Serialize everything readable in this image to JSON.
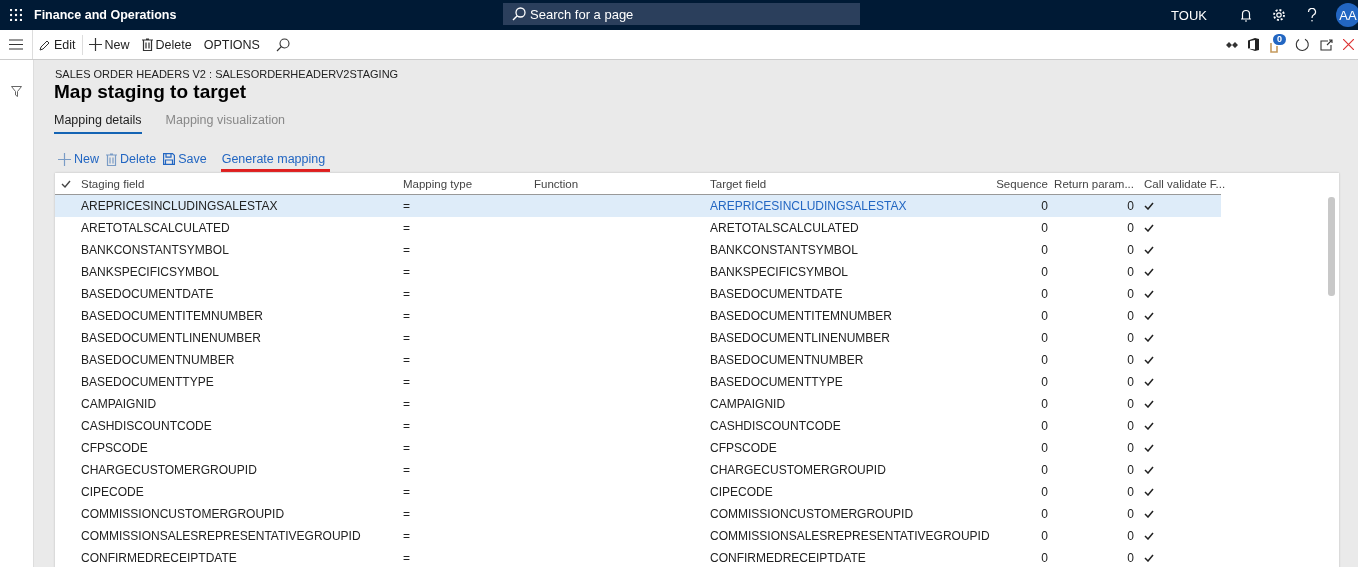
{
  "top_bar": {
    "title": "Finance and Operations",
    "search": {
      "placeholder": "Search for a page"
    },
    "company": "TOUK",
    "avatar": "AA"
  },
  "action_bar": {
    "buttons": [
      {
        "kind": "edit",
        "label": "Edit"
      },
      {
        "kind": "new",
        "label": "New"
      },
      {
        "kind": "delete",
        "label": "Delete"
      },
      {
        "kind": "plain",
        "label": "OPTIONS"
      }
    ],
    "notification_count": "0"
  },
  "page": {
    "caption": "SALES ORDER HEADERS V2 : SALESORDERHEADERV2STAGING",
    "title": "Map staging to target",
    "tabs": [
      {
        "label": "Mapping details",
        "selected": true
      },
      {
        "label": "Mapping visualization",
        "selected": false
      }
    ],
    "toolbar": [
      {
        "kind": "new",
        "label": "New",
        "underlined": false
      },
      {
        "kind": "delete",
        "label": "Delete",
        "underlined": false
      },
      {
        "kind": "save",
        "label": "Save",
        "underlined": false
      },
      {
        "kind": "link",
        "label": "Generate mapping",
        "underlined": true
      }
    ],
    "grid": {
      "columns": [
        "Staging field",
        "Mapping type",
        "Function",
        "Target field",
        "Sequence",
        "Return param...",
        "Call validate F..."
      ],
      "rows": [
        {
          "staging_field": "AREPRICESINCLUDINGSALESTAX",
          "mapping_type": "=",
          "target_field": "AREPRICESINCLUDINGSALESTAX",
          "sequence": "0",
          "return_param": "0",
          "call_validate": true,
          "selected": true
        },
        {
          "staging_field": "ARETOTALSCALCULATED",
          "mapping_type": "=",
          "target_field": "ARETOTALSCALCULATED",
          "sequence": "0",
          "return_param": "0",
          "call_validate": true,
          "selected": false
        },
        {
          "staging_field": "BANKCONSTANTSYMBOL",
          "mapping_type": "=",
          "target_field": "BANKCONSTANTSYMBOL",
          "sequence": "0",
          "return_param": "0",
          "call_validate": true,
          "selected": false
        },
        {
          "staging_field": "BANKSPECIFICSYMBOL",
          "mapping_type": "=",
          "target_field": "BANKSPECIFICSYMBOL",
          "sequence": "0",
          "return_param": "0",
          "call_validate": true,
          "selected": false
        },
        {
          "staging_field": "BASEDOCUMENTDATE",
          "mapping_type": "=",
          "target_field": "BASEDOCUMENTDATE",
          "sequence": "0",
          "return_param": "0",
          "call_validate": true,
          "selected": false
        },
        {
          "staging_field": "BASEDOCUMENTITEMNUMBER",
          "mapping_type": "=",
          "target_field": "BASEDOCUMENTITEMNUMBER",
          "sequence": "0",
          "return_param": "0",
          "call_validate": true,
          "selected": false
        },
        {
          "staging_field": "BASEDOCUMENTLINENUMBER",
          "mapping_type": "=",
          "target_field": "BASEDOCUMENTLINENUMBER",
          "sequence": "0",
          "return_param": "0",
          "call_validate": true,
          "selected": false
        },
        {
          "staging_field": "BASEDOCUMENTNUMBER",
          "mapping_type": "=",
          "target_field": "BASEDOCUMENTNUMBER",
          "sequence": "0",
          "return_param": "0",
          "call_validate": true,
          "selected": false
        },
        {
          "staging_field": "BASEDOCUMENTTYPE",
          "mapping_type": "=",
          "target_field": "BASEDOCUMENTTYPE",
          "sequence": "0",
          "return_param": "0",
          "call_validate": true,
          "selected": false
        },
        {
          "staging_field": "CAMPAIGNID",
          "mapping_type": "=",
          "target_field": "CAMPAIGNID",
          "sequence": "0",
          "return_param": "0",
          "call_validate": true,
          "selected": false
        },
        {
          "staging_field": "CASHDISCOUNTCODE",
          "mapping_type": "=",
          "target_field": "CASHDISCOUNTCODE",
          "sequence": "0",
          "return_param": "0",
          "call_validate": true,
          "selected": false
        },
        {
          "staging_field": "CFPSCODE",
          "mapping_type": "=",
          "target_field": "CFPSCODE",
          "sequence": "0",
          "return_param": "0",
          "call_validate": true,
          "selected": false
        },
        {
          "staging_field": "CHARGECUSTOMERGROUPID",
          "mapping_type": "=",
          "target_field": "CHARGECUSTOMERGROUPID",
          "sequence": "0",
          "return_param": "0",
          "call_validate": true,
          "selected": false
        },
        {
          "staging_field": "CIPECODE",
          "mapping_type": "=",
          "target_field": "CIPECODE",
          "sequence": "0",
          "return_param": "0",
          "call_validate": true,
          "selected": false
        },
        {
          "staging_field": "COMMISSIONCUSTOMERGROUPID",
          "mapping_type": "=",
          "target_field": "COMMISSIONCUSTOMERGROUPID",
          "sequence": "0",
          "return_param": "0",
          "call_validate": true,
          "selected": false
        },
        {
          "staging_field": "COMMISSIONSALESREPRESENTATIVEGROUPID",
          "mapping_type": "=",
          "target_field": "COMMISSIONSALESREPRESENTATIVEGROUPID",
          "sequence": "0",
          "return_param": "0",
          "call_validate": true,
          "selected": false
        },
        {
          "staging_field": "CONFIRMEDRECEIPTDATE",
          "mapping_type": "=",
          "target_field": "CONFIRMEDRECEIPTDATE",
          "sequence": "0",
          "return_param": "0",
          "call_validate": true,
          "selected": false
        }
      ]
    }
  }
}
